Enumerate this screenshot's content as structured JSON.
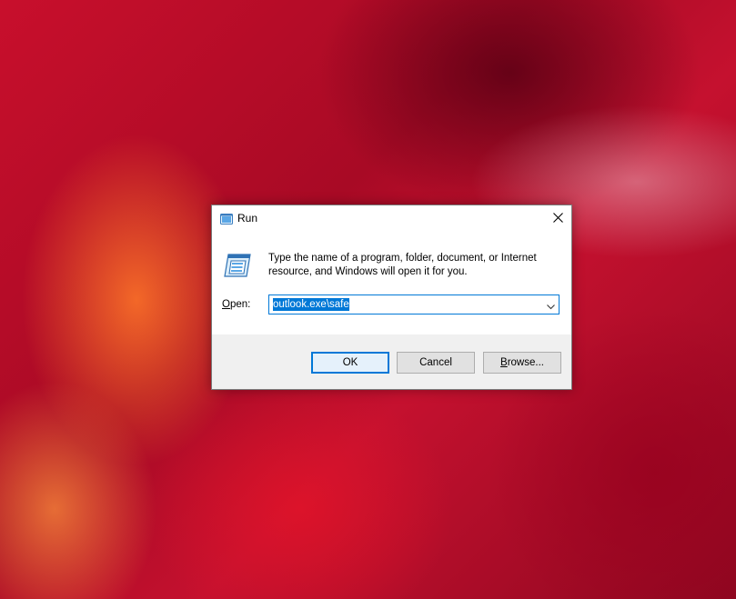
{
  "dialog": {
    "title": "Run",
    "description": "Type the name of a program, folder, document, or Internet resource, and Windows will open it for you.",
    "open_label_mnemonic": "O",
    "open_label_rest": "pen:",
    "open_value": "outlook.exe\\safe",
    "buttons": {
      "ok": "OK",
      "cancel": "Cancel",
      "browse_mnemonic": "B",
      "browse_rest": "rowse..."
    }
  },
  "colors": {
    "accent": "#0078d7",
    "button_face": "#e1e1e1",
    "footer_bg": "#f0f0f0"
  },
  "icons": {
    "title": "run-icon",
    "big": "run-icon",
    "close": "close-icon",
    "dropdown": "chevron-down-icon"
  }
}
